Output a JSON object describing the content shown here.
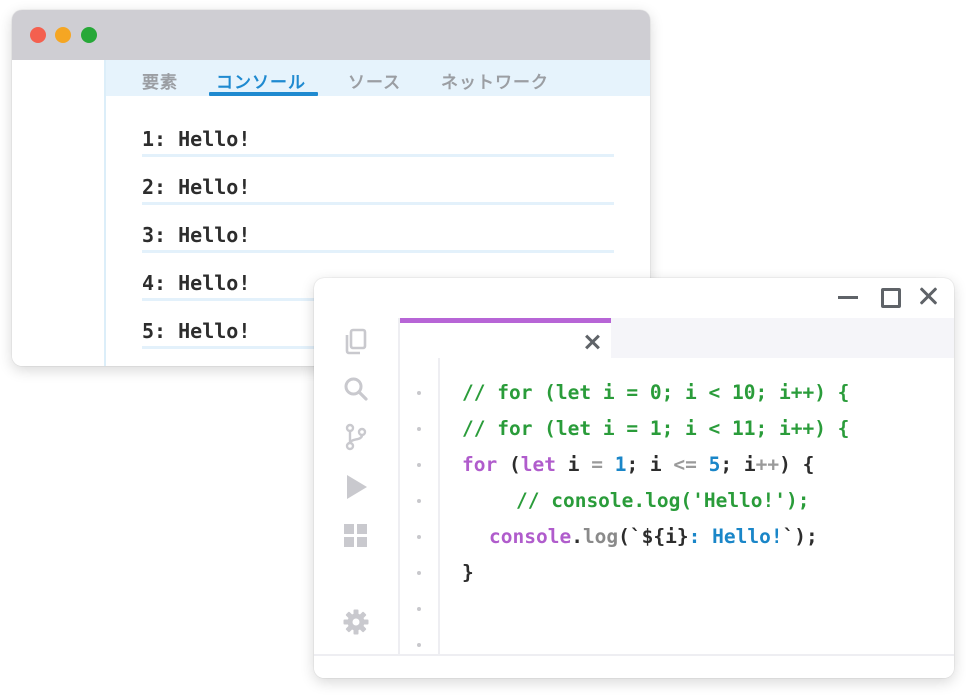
{
  "browser": {
    "devtools_tabs": [
      {
        "label": "要素"
      },
      {
        "label": "コンソール",
        "active": true
      },
      {
        "label": "ソース"
      },
      {
        "label": "ネットワーク"
      }
    ],
    "console_lines": [
      "1: Hello!",
      "2: Hello!",
      "3: Hello!",
      "4: Hello!",
      "5: Hello!"
    ]
  },
  "editor": {
    "activity_icons": [
      "files-icon",
      "search-icon",
      "source-control-icon",
      "run-icon",
      "extensions-icon",
      "settings-icon"
    ],
    "code": {
      "line1": "// for (let i = 0; i < 10; i++) {",
      "line2": "// for (let i = 1; i < 11; i++) {",
      "line3": {
        "kw_for": "for",
        "p1": " (",
        "kw_let": "let",
        "i1": " i ",
        "eq": "=",
        "sp1": " ",
        "n1": "1",
        "semi1": "; i ",
        "le": "<=",
        "sp2": " ",
        "n2": "5",
        "semi2": "; i",
        "inc": "++",
        "close": ") {"
      },
      "line4": "// console.log('Hello!');",
      "line5": {
        "obj": "console",
        "dot": ".",
        "fn": "log",
        "open": "(`",
        "interp_open": "${",
        "var": "i",
        "interp_close": "}",
        "tpl_text": ": Hello!",
        "close": "`);"
      },
      "line6": "}"
    }
  },
  "colors": {
    "accent_blue": "#1f8ad0",
    "tab_accent_purple": "#b765d6",
    "comment_green": "#2a9c3a",
    "keyword_purple": "#b05ccc"
  }
}
